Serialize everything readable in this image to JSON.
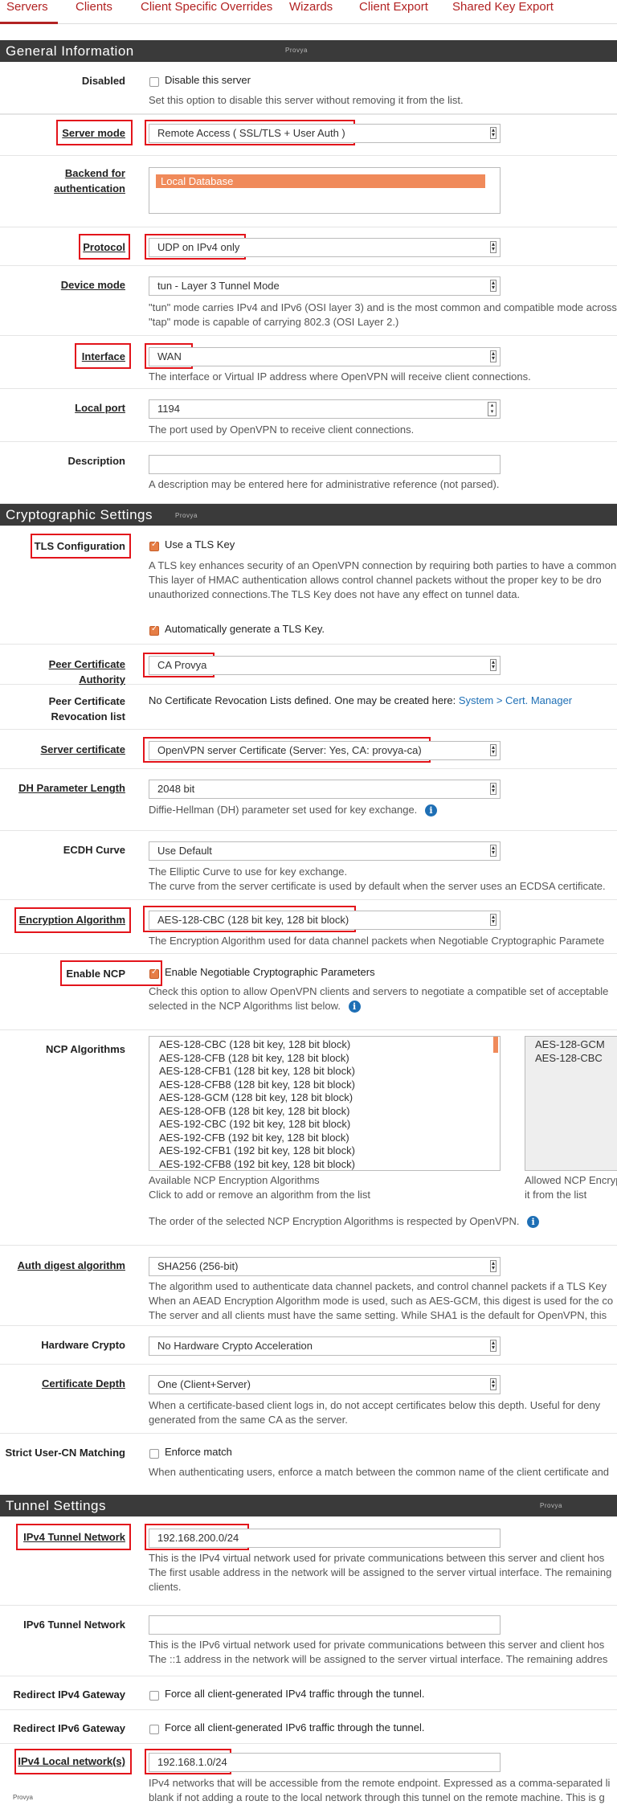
{
  "tabs": [
    "Servers",
    "Clients",
    "Client Specific Overrides",
    "Wizards",
    "Client Export",
    "Shared Key Export"
  ],
  "sections": {
    "general": "General Information",
    "crypto": "Cryptographic Settings",
    "tunnel": "Tunnel Settings",
    "mini_logo": "Provya"
  },
  "general": {
    "disabled_label": "Disabled",
    "disabled_checkbox": "Disable this server",
    "disabled_help": "Set this option to disable this server without removing it from the list.",
    "server_mode_label": "Server mode",
    "server_mode_value": "Remote Access ( SSL/TLS + User Auth )",
    "backend_label_1": "Backend for",
    "backend_label_2": "authentication",
    "backend_value": "Local Database",
    "protocol_label": "Protocol",
    "protocol_value": "UDP on IPv4 only",
    "device_mode_label": "Device mode",
    "device_mode_value": "tun - Layer 3 Tunnel Mode",
    "device_mode_help_1": "\"tun\" mode carries IPv4 and IPv6 (OSI layer 3) and is the most common and compatible mode across",
    "device_mode_help_2": "\"tap\" mode is capable of carrying 802.3 (OSI Layer 2.)",
    "interface_label": "Interface",
    "interface_value": "WAN",
    "interface_help": "The interface or Virtual IP address where OpenVPN will receive client connections.",
    "local_port_label": "Local port",
    "local_port_value": "1194",
    "local_port_help": "The port used by OpenVPN to receive client connections.",
    "description_label": "Description",
    "description_value": "",
    "description_help": "A description may be entered here for administrative reference (not parsed)."
  },
  "crypto": {
    "tls_label": "TLS Configuration",
    "tls_checkbox": "Use a TLS Key",
    "tls_help_1": "A TLS key enhances security of an OpenVPN connection by requiring both parties to have a common",
    "tls_help_2": "This layer of HMAC authentication allows control channel packets without the proper key to be dro",
    "tls_help_3": "unauthorized connections.The TLS Key does not have any effect on tunnel data.",
    "tls_autogen": "Automatically generate a TLS Key.",
    "peer_ca_label": "Peer Certificate Authority",
    "peer_ca_value": "CA Provya",
    "crl_label_1": "Peer Certificate",
    "crl_label_2": "Revocation list",
    "crl_text": "No Certificate Revocation Lists defined. One may be created here: ",
    "crl_link": "System > Cert. Manager",
    "server_cert_label": "Server certificate",
    "server_cert_value": "OpenVPN server Certificate (Server: Yes, CA: provya-ca)",
    "dh_label": "DH Parameter Length",
    "dh_value": "2048 bit",
    "dh_help": "Diffie-Hellman (DH) parameter set used for key exchange.",
    "ecdh_label": "ECDH Curve",
    "ecdh_value": "Use Default",
    "ecdh_help_1": "The Elliptic Curve to use for key exchange.",
    "ecdh_help_2": "The curve from the server certificate is used by default when the server uses an ECDSA certificate.",
    "enc_label": "Encryption Algorithm",
    "enc_value": "AES-128-CBC (128 bit key, 128 bit block)",
    "enc_help": "The Encryption Algorithm used for data channel packets when Negotiable Cryptographic Paramete",
    "ncp_label": "Enable NCP",
    "ncp_checkbox": "Enable Negotiable Cryptographic Parameters",
    "ncp_help_1": "Check this option to allow OpenVPN clients and servers to negotiate a compatible set of acceptable",
    "ncp_help_2": "selected in the NCP Algorithms list below.",
    "ncp_alg_label": "NCP Algorithms",
    "ncp_available": [
      "AES-128-CBC (128 bit key, 128 bit block)",
      "AES-128-CFB (128 bit key, 128 bit block)",
      "AES-128-CFB1 (128 bit key, 128 bit block)",
      "AES-128-CFB8 (128 bit key, 128 bit block)",
      "AES-128-GCM (128 bit key, 128 bit block)",
      "AES-128-OFB (128 bit key, 128 bit block)",
      "AES-192-CBC (192 bit key, 128 bit block)",
      "AES-192-CFB (192 bit key, 128 bit block)",
      "AES-192-CFB1 (192 bit key, 128 bit block)",
      "AES-192-CFB8 (192 bit key, 128 bit block)"
    ],
    "ncp_allowed": [
      "AES-128-GCM",
      "AES-128-CBC"
    ],
    "ncp_avail_caption_1": "Available NCP Encryption Algorithms",
    "ncp_avail_caption_2": "Click to add or remove an algorithm from the list",
    "ncp_allowed_caption_1": "Allowed NCP Encryp",
    "ncp_allowed_caption_2": "it from the list",
    "ncp_order_help": "The order of the selected NCP Encryption Algorithms is respected by OpenVPN.",
    "auth_label": "Auth digest algorithm",
    "auth_value": "SHA256 (256-bit)",
    "auth_help_1": "The algorithm used to authenticate data channel packets, and control channel packets if a TLS Key",
    "auth_help_2": "When an AEAD Encryption Algorithm mode is used, such as AES-GCM, this digest is used for the co",
    "auth_help_3": "The server and all clients must have the same setting. While SHA1 is the default for OpenVPN, this",
    "hw_label": "Hardware Crypto",
    "hw_value": "No Hardware Crypto Acceleration",
    "depth_label": "Certificate Depth",
    "depth_value": "One (Client+Server)",
    "depth_help_1": "When a certificate-based client logs in, do not accept certificates below this depth. Useful for deny",
    "depth_help_2": "generated from the same CA as the server.",
    "strict_label": "Strict User-CN Matching",
    "strict_checkbox": "Enforce match",
    "strict_help": "When authenticating users, enforce a match between the common name of the client certificate and"
  },
  "tunnel": {
    "ipv4_net_label": "IPv4 Tunnel Network",
    "ipv4_net_value": "192.168.200.0/24",
    "ipv4_net_help_1": "This is the IPv4 virtual network used for private communications between this server and client hos",
    "ipv4_net_help_2": "The first usable address in the network will be assigned to the server virtual interface. The remaining",
    "ipv4_net_help_3": "clients.",
    "ipv6_net_label": "IPv6 Tunnel Network",
    "ipv6_net_value": "",
    "ipv6_net_help_1": "This is the IPv6 virtual network used for private communications between this server and client hos",
    "ipv6_net_help_2": "The ::1 address in the network will be assigned to the server virtual interface. The remaining addres",
    "redir4_label": "Redirect IPv4 Gateway",
    "redir4_checkbox": "Force all client-generated IPv4 traffic through the tunnel.",
    "redir6_label": "Redirect IPv6 Gateway",
    "redir6_checkbox": "Force all client-generated IPv6 traffic through the tunnel.",
    "local4_label": "IPv4 Local network(s)",
    "local4_value": "192.168.1.0/24",
    "local4_help_1": "IPv4 networks that will be accessible from the remote endpoint. Expressed as a comma-separated li",
    "local4_help_2": "blank if not adding a route to the local network through this tunnel on the remote machine. This is g"
  }
}
